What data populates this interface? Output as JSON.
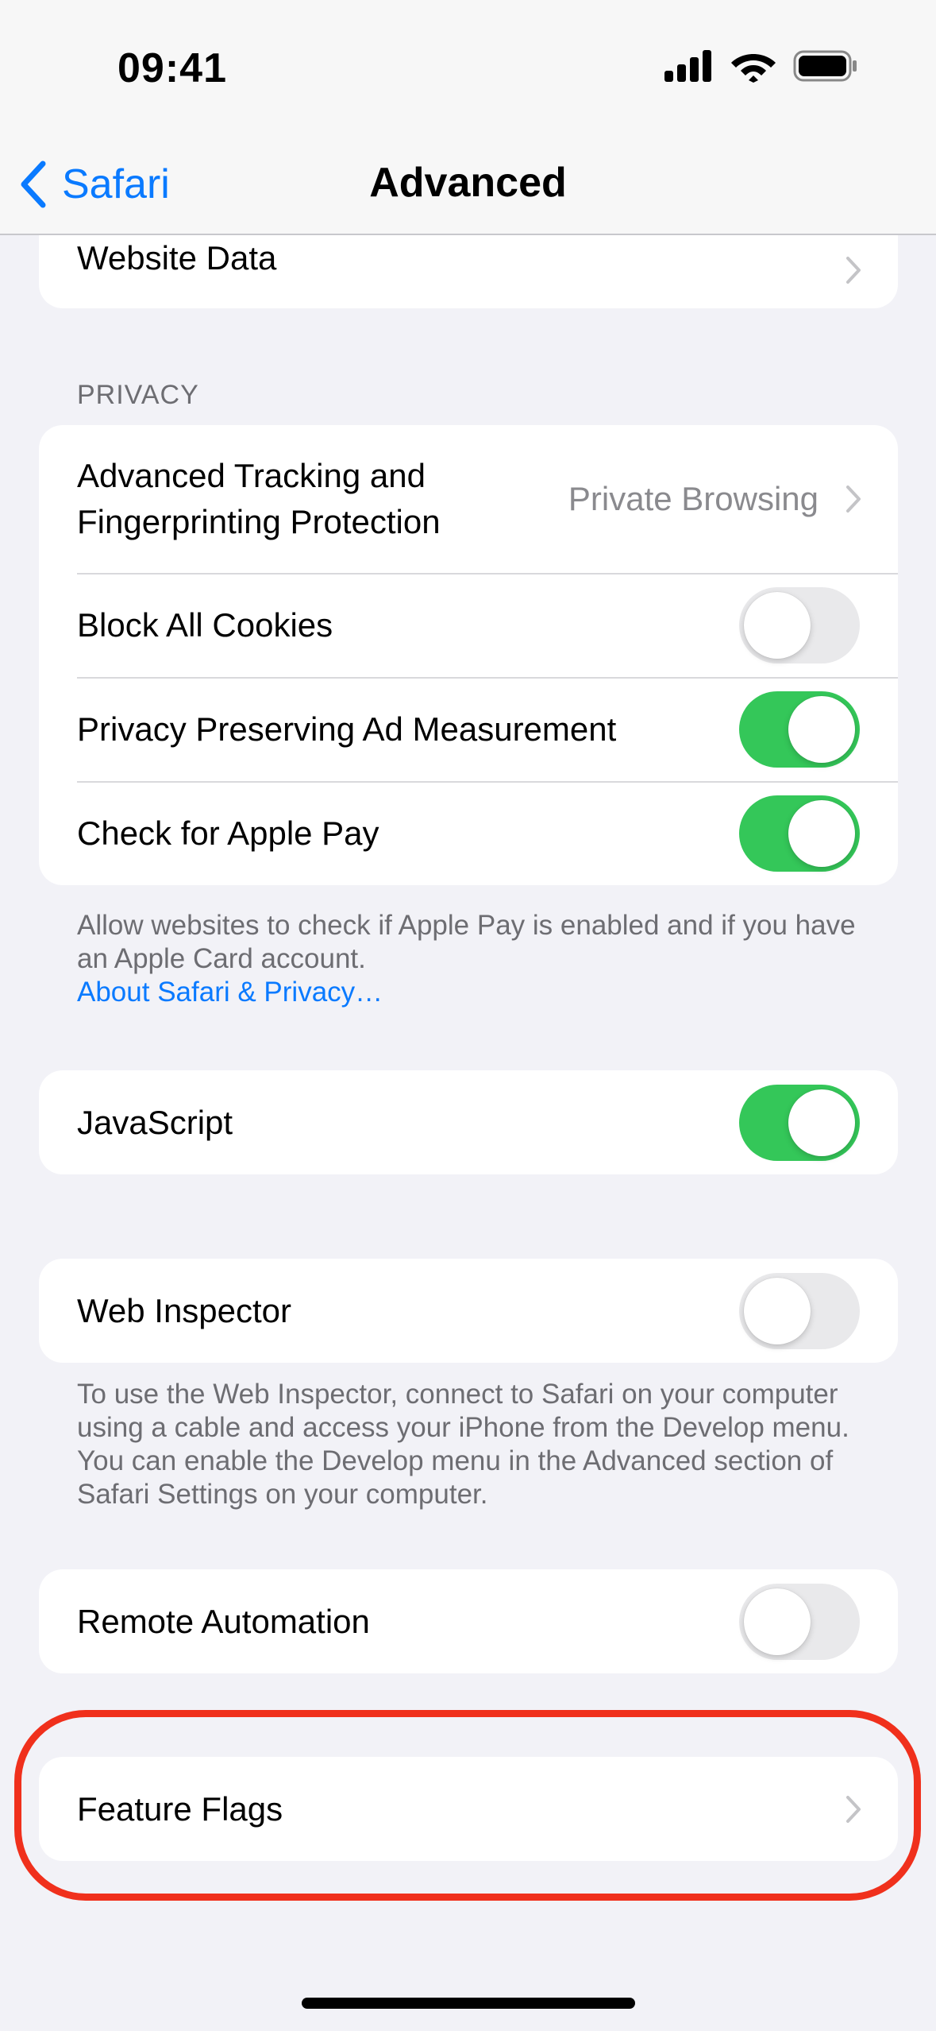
{
  "status_bar": {
    "time": "09:41",
    "icons": [
      "cellular-signal-icon",
      "wifi-icon",
      "battery-icon"
    ]
  },
  "nav": {
    "back_label": "Safari",
    "title": "Advanced"
  },
  "website_data": {
    "label": "Website Data"
  },
  "privacy": {
    "header": "PRIVACY",
    "tracking": {
      "label_line1": "Advanced Tracking and",
      "label_line2": "Fingerprinting Protection",
      "value": "Private Browsing"
    },
    "block_cookies": {
      "label": "Block All Cookies",
      "on": false
    },
    "ad_measurement": {
      "label": "Privacy Preserving Ad Measurement",
      "on": true
    },
    "apple_pay": {
      "label": "Check for Apple Pay",
      "on": true
    },
    "footnote": "Allow websites to check if Apple Pay is enabled and if you have an Apple Card account.",
    "footnote_link": "About Safari & Privacy…"
  },
  "javascript": {
    "label": "JavaScript",
    "on": true
  },
  "web_inspector": {
    "label": "Web Inspector",
    "on": false,
    "footnote": "To use the Web Inspector, connect to Safari on your computer using a cable and access your iPhone from the Develop menu. You can enable the Develop menu in the Advanced section of Safari Settings on your computer."
  },
  "remote_automation": {
    "label": "Remote Automation",
    "on": false
  },
  "feature_flags": {
    "label": "Feature Flags"
  },
  "colors": {
    "accent": "#0a7aff",
    "toggle_on": "#34c759",
    "toggle_off": "#e9e9eb",
    "highlight": "#f0301c",
    "background": "#f2f2f7"
  }
}
